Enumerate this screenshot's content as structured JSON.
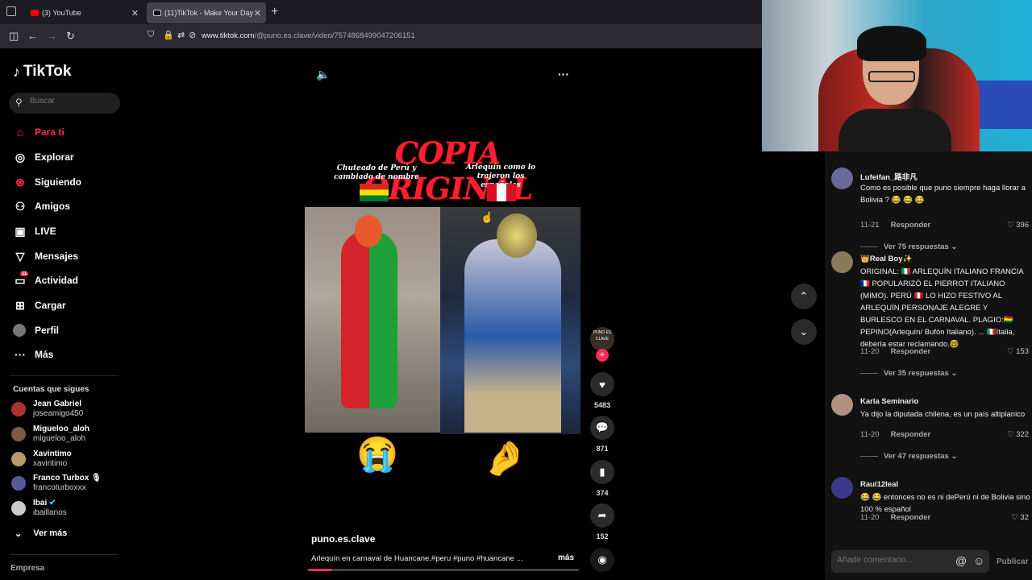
{
  "browser": {
    "tabs": [
      {
        "label": "(3) YouTube"
      },
      {
        "label": "(11)TikTok - Make Your Day"
      }
    ],
    "url_domain": "www.tiktok.com",
    "url_path": "/@puno.es.clave/video/7574868499047206151"
  },
  "sidebar": {
    "logo": "TikTok",
    "search_placeholder": "Buscar",
    "menu": [
      {
        "label": "Para ti",
        "icon": "home-icon"
      },
      {
        "label": "Explorar",
        "icon": "compass-icon"
      },
      {
        "label": "Siguiendo",
        "icon": "following-icon"
      },
      {
        "label": "Amigos",
        "icon": "friends-icon"
      },
      {
        "label": "LIVE",
        "icon": "live-icon"
      },
      {
        "label": "Mensajes",
        "icon": "send-icon"
      },
      {
        "label": "Actividad",
        "icon": "activity-icon",
        "badge": "11"
      },
      {
        "label": "Cargar",
        "icon": "upload-icon"
      },
      {
        "label": "Perfil",
        "icon": "avatar-icon"
      },
      {
        "label": "Más",
        "icon": "more-icon"
      }
    ],
    "following_title": "Cuentas que sigues",
    "following": [
      {
        "name": "Jean Gabriel",
        "user": "joseamigo450"
      },
      {
        "name": "Migueloo_aloh",
        "user": "migueloo_aloh"
      },
      {
        "name": "Xavintimo",
        "user": "xavintimo"
      },
      {
        "name": "Franco Turbox 🎙",
        "user": "francoturboxxx"
      },
      {
        "name": "Ibai",
        "user": "ibaillanos"
      }
    ],
    "see_more": "Ver más",
    "footer": "Empresa"
  },
  "video": {
    "title": "COPIA ORIGINAL",
    "caption_left": "Chuteado de Perú y cambiado de nombre",
    "caption_right": "Arlequín como lo trajeron los españoles",
    "emoji_left": "😭",
    "emoji_right": "🤌",
    "author": "puno.es.clave",
    "description": "Arlequín en carnaval de Huancane.#peru #puno #huancane ...",
    "more": "más",
    "progress": 0.09,
    "profile_label": "PUNO ES CLAVE"
  },
  "actions": {
    "likes": "5483",
    "comments": "871",
    "saves": "374",
    "shares": "152"
  },
  "comments": {
    "items": [
      {
        "name": "Lufeifan_路非凡",
        "text": "Como es posible que puno siempre haga llorar a Bolivia ? 😂 😂 😂",
        "date": "11-21",
        "reply": "Responder",
        "likes": "396",
        "more": "Ver 75 respuestas"
      },
      {
        "name": "👑Real Boy✨",
        "text": "ORIGINAL: 🇮🇹 ARLEQUÍN ITALIANO FRANCIA 🇫🇷 POPULARIZÓ EL PIERROT ITALIANO (MIMO). PERÚ 🇵🇪 LO HIZO FESTIVO AL ARLEQUÍN,PERSONAJE ALEGRE Y BURLESCO EN EL CARNAVAL. PLAGIO:🇧🇴 PEPINO(Arlequín/ Bufón Italiano). ... 🇮🇹Italia, debería estar reclamando.🤓",
        "date": "11-20",
        "reply": "Responder",
        "likes": "153",
        "more": "Ver 35 respuestas"
      },
      {
        "name": "Karla Seminario",
        "text": "Ya dijo la diputada chilena, es un país altiplanico",
        "date": "11-20",
        "reply": "Responder",
        "likes": "322",
        "more": "Ver 47 respuestas"
      },
      {
        "name": "Raul12leal",
        "text": "😂 😂 entonces no es ni dePerú ni de Bolivia sino 100 % español",
        "date": "11-20",
        "reply": "Responder",
        "likes": "32",
        "more": ""
      }
    ],
    "input_placeholder": "Añadir comentario...",
    "publish": "Publicar"
  },
  "colors": {
    "accent": "#fe2c55",
    "title_red": "#ff1f2e"
  }
}
